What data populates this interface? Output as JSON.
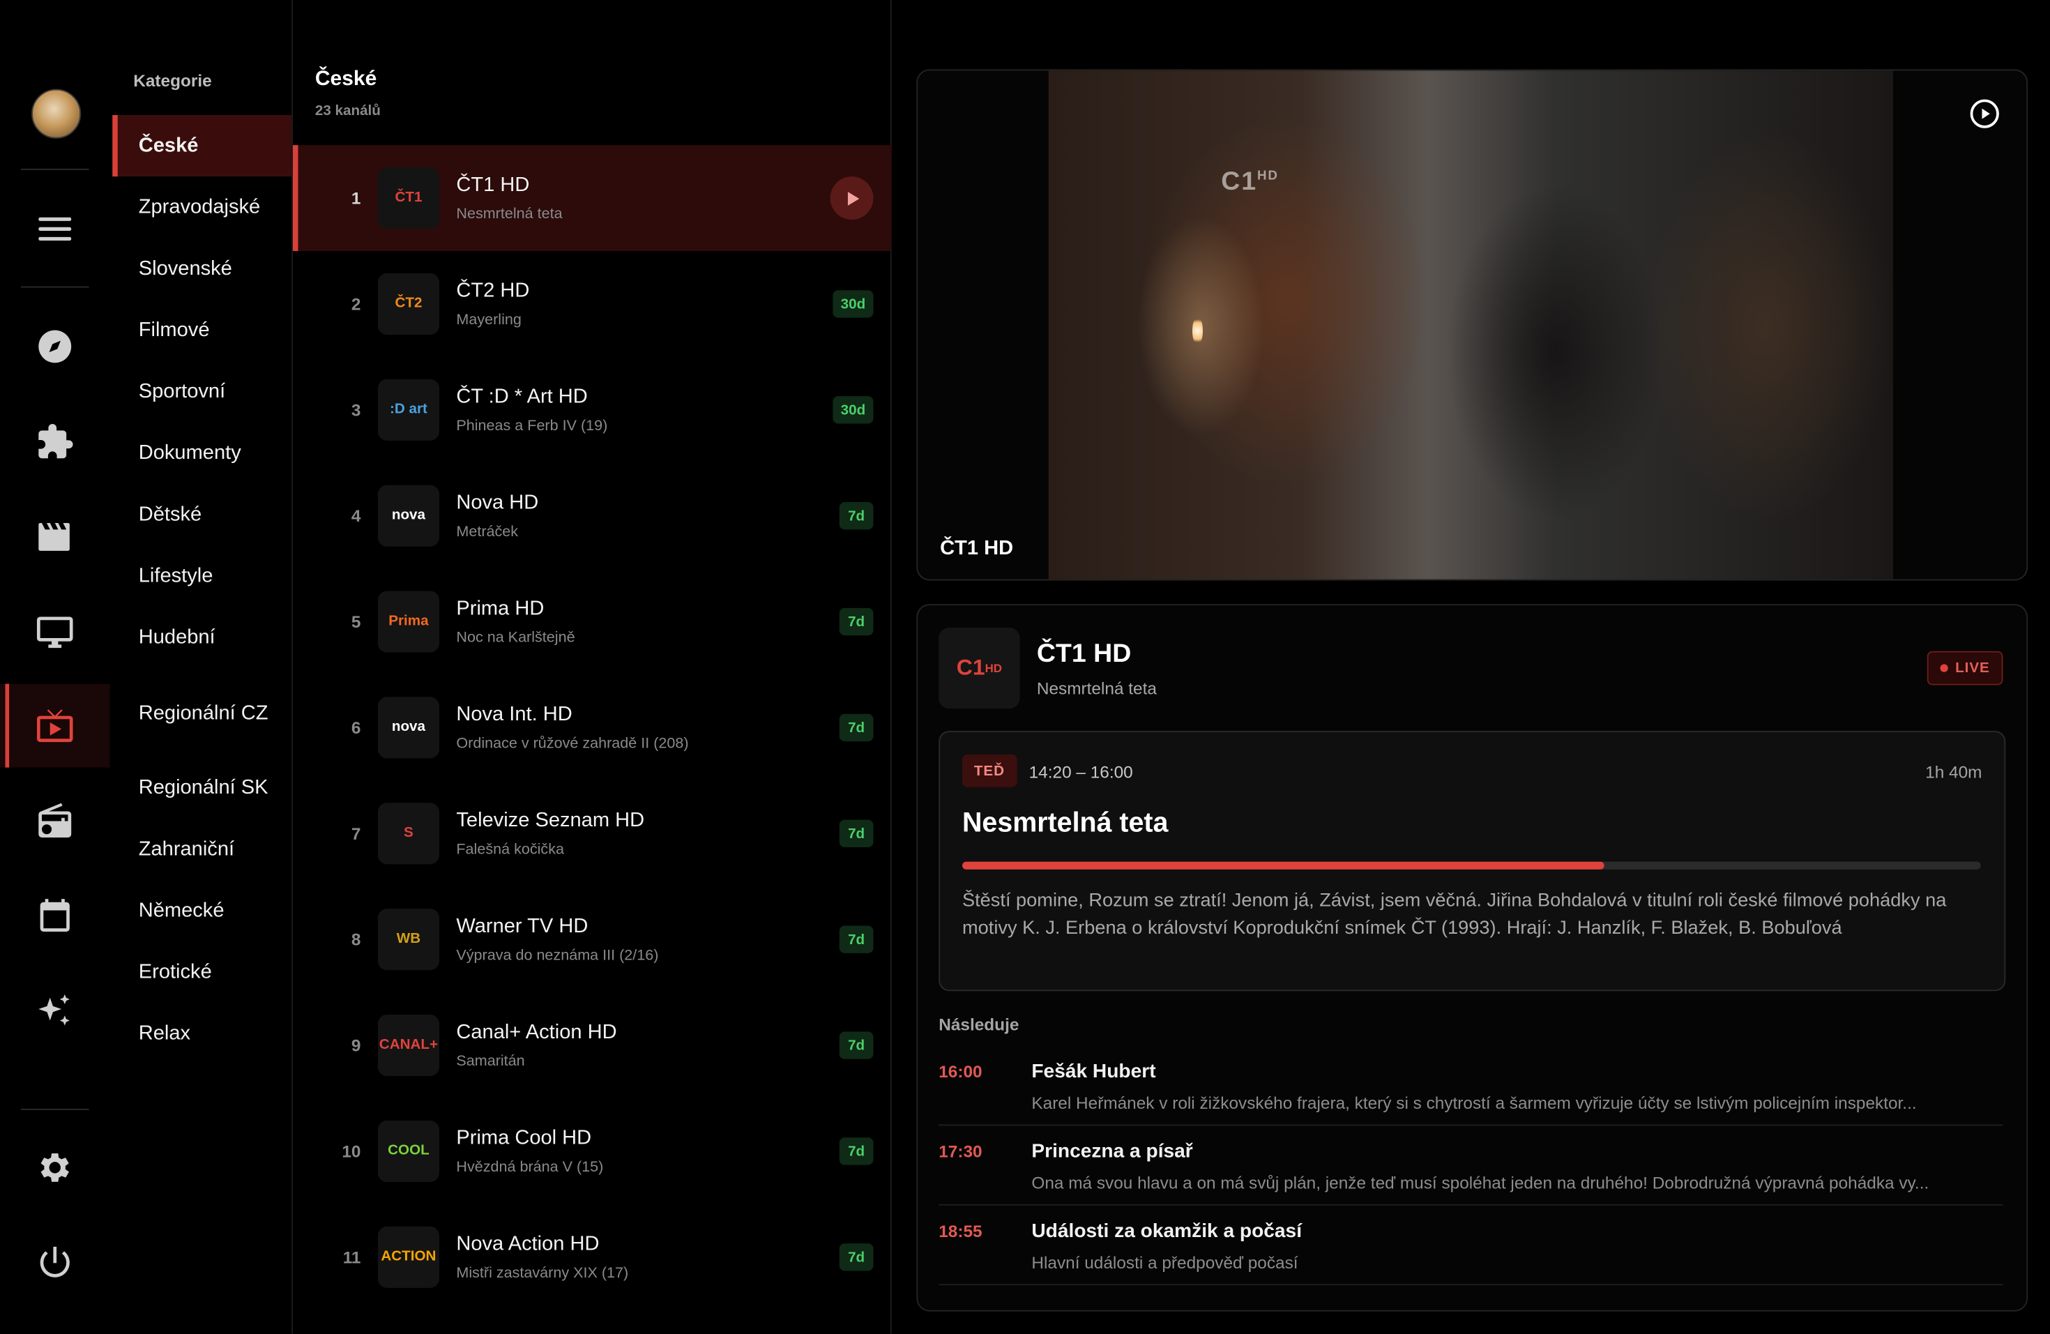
{
  "rail": {
    "items": [
      {
        "name": "menu"
      },
      {
        "name": "explore"
      },
      {
        "name": "addons"
      },
      {
        "name": "movies"
      },
      {
        "name": "tv"
      },
      {
        "name": "live-tv"
      },
      {
        "name": "radio"
      },
      {
        "name": "calendar"
      },
      {
        "name": "ai"
      },
      {
        "name": "settings"
      },
      {
        "name": "power"
      }
    ],
    "active_color": "#e0433c"
  },
  "categories": {
    "header": "Kategorie",
    "items": [
      "České",
      "Zpravodajské",
      "Slovenské",
      "Filmové",
      "Sportovní",
      "Dokumenty",
      "Dětské",
      "Lifestyle",
      "Hudební",
      "Regionální CZ",
      "Regionální SK",
      "Zahraniční",
      "Německé",
      "Erotické",
      "Relax"
    ],
    "active": "České"
  },
  "channel_list": {
    "title": "České",
    "count": "23 kanálů",
    "channels": [
      {
        "num": "1",
        "name": "ČT1 HD",
        "program": "Nesmrtelná teta",
        "badge": "",
        "logo": "ČT1"
      },
      {
        "num": "2",
        "name": "ČT2 HD",
        "program": "Mayerling",
        "badge": "30d",
        "logo": "ČT2"
      },
      {
        "num": "3",
        "name": "ČT :D * Art HD",
        "program": "Phineas a Ferb IV (19)",
        "badge": "30d",
        "logo": ":D art"
      },
      {
        "num": "4",
        "name": "Nova HD",
        "program": "Metráček",
        "badge": "7d",
        "logo": "nova"
      },
      {
        "num": "5",
        "name": "Prima HD",
        "program": "Noc na Karlštejně",
        "badge": "7d",
        "logo": "Prima"
      },
      {
        "num": "6",
        "name": "Nova Int. HD",
        "program": "Ordinace v růžové zahradě II (208)",
        "badge": "7d",
        "logo": "nova"
      },
      {
        "num": "7",
        "name": "Televize Seznam HD",
        "program": "Falešná kočička",
        "badge": "7d",
        "logo": "S"
      },
      {
        "num": "8",
        "name": "Warner TV HD",
        "program": "Výprava do neznáma III (2/16)",
        "badge": "7d",
        "logo": "WB"
      },
      {
        "num": "9",
        "name": "Canal+ Action HD",
        "program": "Samaritán",
        "badge": "7d",
        "logo": "CANAL+"
      },
      {
        "num": "10",
        "name": "Prima Cool HD",
        "program": "Hvězdná brána V (15)",
        "badge": "7d",
        "logo": "COOL"
      },
      {
        "num": "11",
        "name": "Nova Action HD",
        "program": "Mistři zastavárny XIX (17)",
        "badge": "7d",
        "logo": "ACTION"
      }
    ]
  },
  "player": {
    "channel_label": "ČT1 HD",
    "video_logo": "1",
    "video_logo_sup": "HD"
  },
  "details": {
    "channel_name": "ČT1 HD",
    "program": "Nesmrtelná teta",
    "logo": "1",
    "live_label": "LIVE",
    "now": {
      "tag": "TEĎ",
      "time": "14:20 – 16:00",
      "duration": "1h 40m",
      "title": "Nesmrtelná teta",
      "progress": 0.63,
      "description": "Štěstí pomine, Rozum se ztratí! Jenom já, Závist, jsem věčná. Jiřina Bohdalová v titulní roli české filmové pohádky na motivy K. J. Erbena o království Koprodukční snímek ČT (1993). Hrají: J. Hanzlík, F. Blažek, B. Bobuľová"
    },
    "next_header": "Následuje",
    "next": [
      {
        "time": "16:00",
        "title": "Fešák Hubert",
        "desc": "Karel Heřmánek v roli žižkovského frajera, který si s chytrostí a šarmem vyřizuje účty se lstivým policejním inspektor..."
      },
      {
        "time": "17:30",
        "title": "Princezna a písař",
        "desc": "Ona má svou hlavu a on má svůj plán, jenže teď musí spoléhat jeden na druhého! Dobrodružná výpravná pohádka vy..."
      },
      {
        "time": "18:55",
        "title": "Události za okamžik a počasí",
        "desc": "Hlavní události a předpověď počasí"
      }
    ]
  }
}
